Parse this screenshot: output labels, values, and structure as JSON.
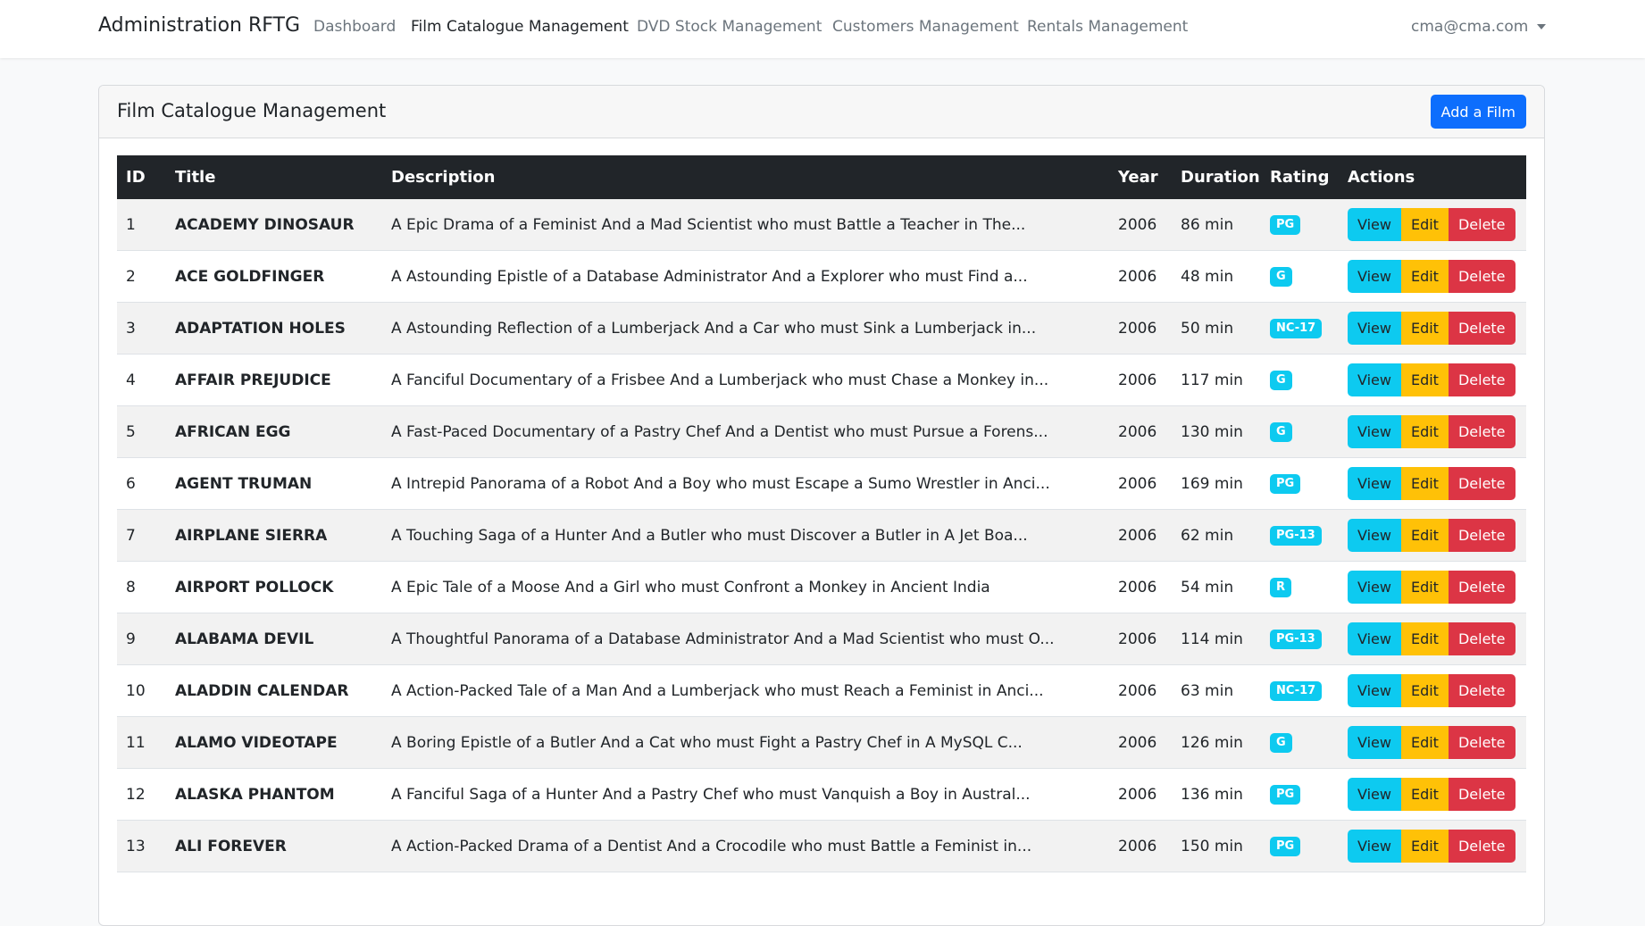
{
  "nav": {
    "brand": "Administration RFTG",
    "links": [
      "Dashboard",
      "Film Catalogue Management",
      "DVD Stock Management",
      "Customers Management",
      "Rentals Management"
    ],
    "active": "Film Catalogue Management",
    "user": "cma@cma.com"
  },
  "card": {
    "title": "Film Catalogue Management",
    "add_button": "Add a Film"
  },
  "table": {
    "headers": [
      "ID",
      "Title",
      "Description",
      "Year",
      "Duration",
      "Rating",
      "Actions"
    ],
    "action_labels": {
      "view": "View",
      "edit": "Edit",
      "delete": "Delete"
    },
    "rows": [
      {
        "id": "1",
        "title": "ACADEMY DINOSAUR",
        "description": "A Epic Drama of a Feminist And a Mad Scientist who must Battle a Teacher in The...",
        "year": "2006",
        "duration": "86 min",
        "rating": "PG"
      },
      {
        "id": "2",
        "title": "ACE GOLDFINGER",
        "description": "A Astounding Epistle of a Database Administrator And a Explorer who must Find a...",
        "year": "2006",
        "duration": "48 min",
        "rating": "G"
      },
      {
        "id": "3",
        "title": "ADAPTATION HOLES",
        "description": "A Astounding Reflection of a Lumberjack And a Car who must Sink a Lumberjack in...",
        "year": "2006",
        "duration": "50 min",
        "rating": "NC-17"
      },
      {
        "id": "4",
        "title": "AFFAIR PREJUDICE",
        "description": "A Fanciful Documentary of a Frisbee And a Lumberjack who must Chase a Monkey in...",
        "year": "2006",
        "duration": "117 min",
        "rating": "G"
      },
      {
        "id": "5",
        "title": "AFRICAN EGG",
        "description": "A Fast-Paced Documentary of a Pastry Chef And a Dentist who must Pursue a Forens...",
        "year": "2006",
        "duration": "130 min",
        "rating": "G"
      },
      {
        "id": "6",
        "title": "AGENT TRUMAN",
        "description": "A Intrepid Panorama of a Robot And a Boy who must Escape a Sumo Wrestler in Anci...",
        "year": "2006",
        "duration": "169 min",
        "rating": "PG"
      },
      {
        "id": "7",
        "title": "AIRPLANE SIERRA",
        "description": "A Touching Saga of a Hunter And a Butler who must Discover a Butler in A Jet Boa...",
        "year": "2006",
        "duration": "62 min",
        "rating": "PG-13"
      },
      {
        "id": "8",
        "title": "AIRPORT POLLOCK",
        "description": "A Epic Tale of a Moose And a Girl who must Confront a Monkey in Ancient India",
        "year": "2006",
        "duration": "54 min",
        "rating": "R"
      },
      {
        "id": "9",
        "title": "ALABAMA DEVIL",
        "description": "A Thoughtful Panorama of a Database Administrator And a Mad Scientist who must O...",
        "year": "2006",
        "duration": "114 min",
        "rating": "PG-13"
      },
      {
        "id": "10",
        "title": "ALADDIN CALENDAR",
        "description": "A Action-Packed Tale of a Man And a Lumberjack who must Reach a Feminist in Anci...",
        "year": "2006",
        "duration": "63 min",
        "rating": "NC-17"
      },
      {
        "id": "11",
        "title": "ALAMO VIDEOTAPE",
        "description": "A Boring Epistle of a Butler And a Cat who must Fight a Pastry Chef in A MySQL C...",
        "year": "2006",
        "duration": "126 min",
        "rating": "G"
      },
      {
        "id": "12",
        "title": "ALASKA PHANTOM",
        "description": "A Fanciful Saga of a Hunter And a Pastry Chef who must Vanquish a Boy in Austral...",
        "year": "2006",
        "duration": "136 min",
        "rating": "PG"
      },
      {
        "id": "13",
        "title": "ALI FOREVER",
        "description": "A Action-Packed Drama of a Dentist And a Crocodile who must Battle a Feminist in...",
        "year": "2006",
        "duration": "150 min",
        "rating": "PG"
      }
    ]
  }
}
